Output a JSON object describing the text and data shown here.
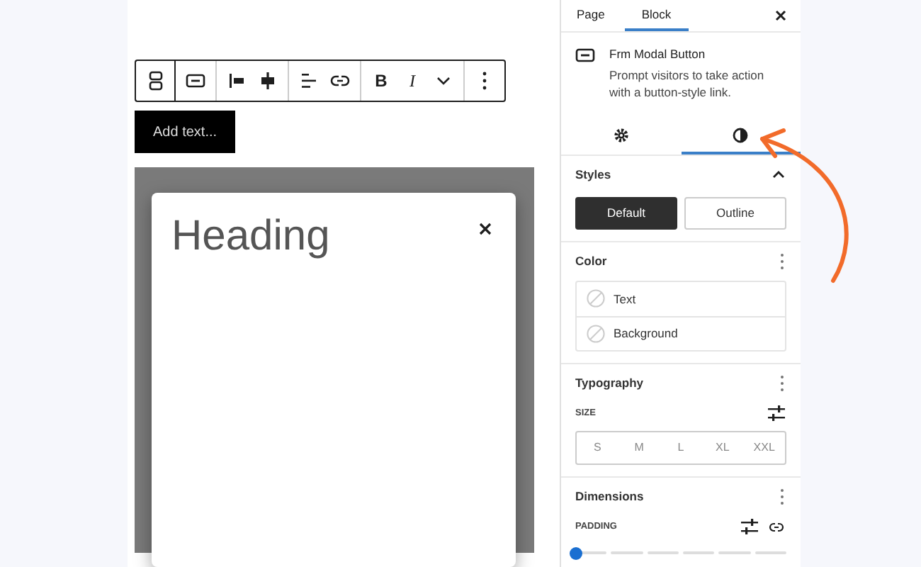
{
  "editor": {
    "toolbar": {
      "bold": "B",
      "italic": "I"
    },
    "button": {
      "text": "Add text..."
    },
    "modal": {
      "heading": "Heading"
    }
  },
  "sidebar": {
    "tabs": [
      {
        "label": "Page",
        "selected": false
      },
      {
        "label": "Block",
        "selected": true
      }
    ],
    "block": {
      "title": "Frm Modal Button",
      "description": "Prompt visitors to take action with a button-style link."
    },
    "sub_tabs": [
      {
        "kind": "settings",
        "selected": false
      },
      {
        "kind": "styles",
        "selected": true
      }
    ],
    "styles": {
      "title": "Styles",
      "expanded": true,
      "options": [
        {
          "label": "Default",
          "selected": true
        },
        {
          "label": "Outline",
          "selected": false
        }
      ]
    },
    "color": {
      "title": "Color",
      "items": [
        "Text",
        "Background"
      ]
    },
    "typography": {
      "title": "Typography",
      "size_label": "SIZE",
      "sizes": [
        {
          "label": "S",
          "selected": false
        },
        {
          "label": "M",
          "selected": false
        },
        {
          "label": "L",
          "selected": false
        },
        {
          "label": "XL",
          "selected": false
        },
        {
          "label": "XXL",
          "selected": false
        }
      ]
    },
    "dimensions": {
      "title": "Dimensions",
      "padding_label": "PADDING",
      "padding": {
        "level": 0
      }
    }
  }
}
